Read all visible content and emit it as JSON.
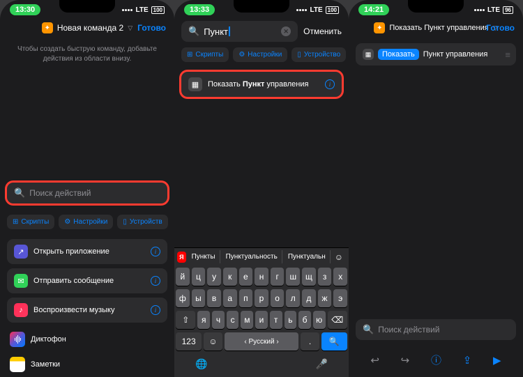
{
  "screen1": {
    "time": "13:30",
    "lte": "LTE",
    "battery": "100",
    "shortcut_title": "Новая команда 2",
    "done": "Готово",
    "hint": "Чтобы создать быструю команду, добавьте действия из области внизу.",
    "search_placeholder": "Поиск действий",
    "pills": {
      "scripts": "Скрипты",
      "settings": "Настройки",
      "device": "Устройств"
    },
    "actions": {
      "open_app": "Открыть приложение",
      "send_msg": "Отправить сообщение",
      "play_music": "Воспроизвести музыку",
      "dictaphone": "Диктофон",
      "notes": "Заметки"
    }
  },
  "screen2": {
    "time": "13:33",
    "lte": "LTE",
    "battery": "100",
    "search_value": "Пункт",
    "cancel": "Отменить",
    "pills": {
      "scripts": "Скрипты",
      "settings": "Настройки",
      "device": "Устройство"
    },
    "result_prefix": "Показать ",
    "result_bold": "Пункт",
    "result_suffix": " управления",
    "suggestions": {
      "s1": "Пункты",
      "s2": "Пунктуальность",
      "s3": "Пунктуальн"
    },
    "keys_r1": [
      "й",
      "ц",
      "у",
      "к",
      "е",
      "н",
      "г",
      "ш",
      "щ",
      "з",
      "х"
    ],
    "keys_r2": [
      "ф",
      "ы",
      "в",
      "а",
      "п",
      "р",
      "о",
      "л",
      "д",
      "ж",
      "э"
    ],
    "keys_r3": [
      "я",
      "ч",
      "с",
      "м",
      "и",
      "т",
      "ь",
      "б",
      "ю"
    ],
    "key_123": "123",
    "key_space": "‹ Русский ›",
    "key_dot": "."
  },
  "screen3": {
    "time": "14:21",
    "lte": "LTE",
    "battery": "96",
    "shortcut_title": "Показать Пункт управления",
    "done": "Готово",
    "step_action": "Показать",
    "step_rest": "Пункт управления",
    "search_placeholder": "Поиск действий"
  }
}
